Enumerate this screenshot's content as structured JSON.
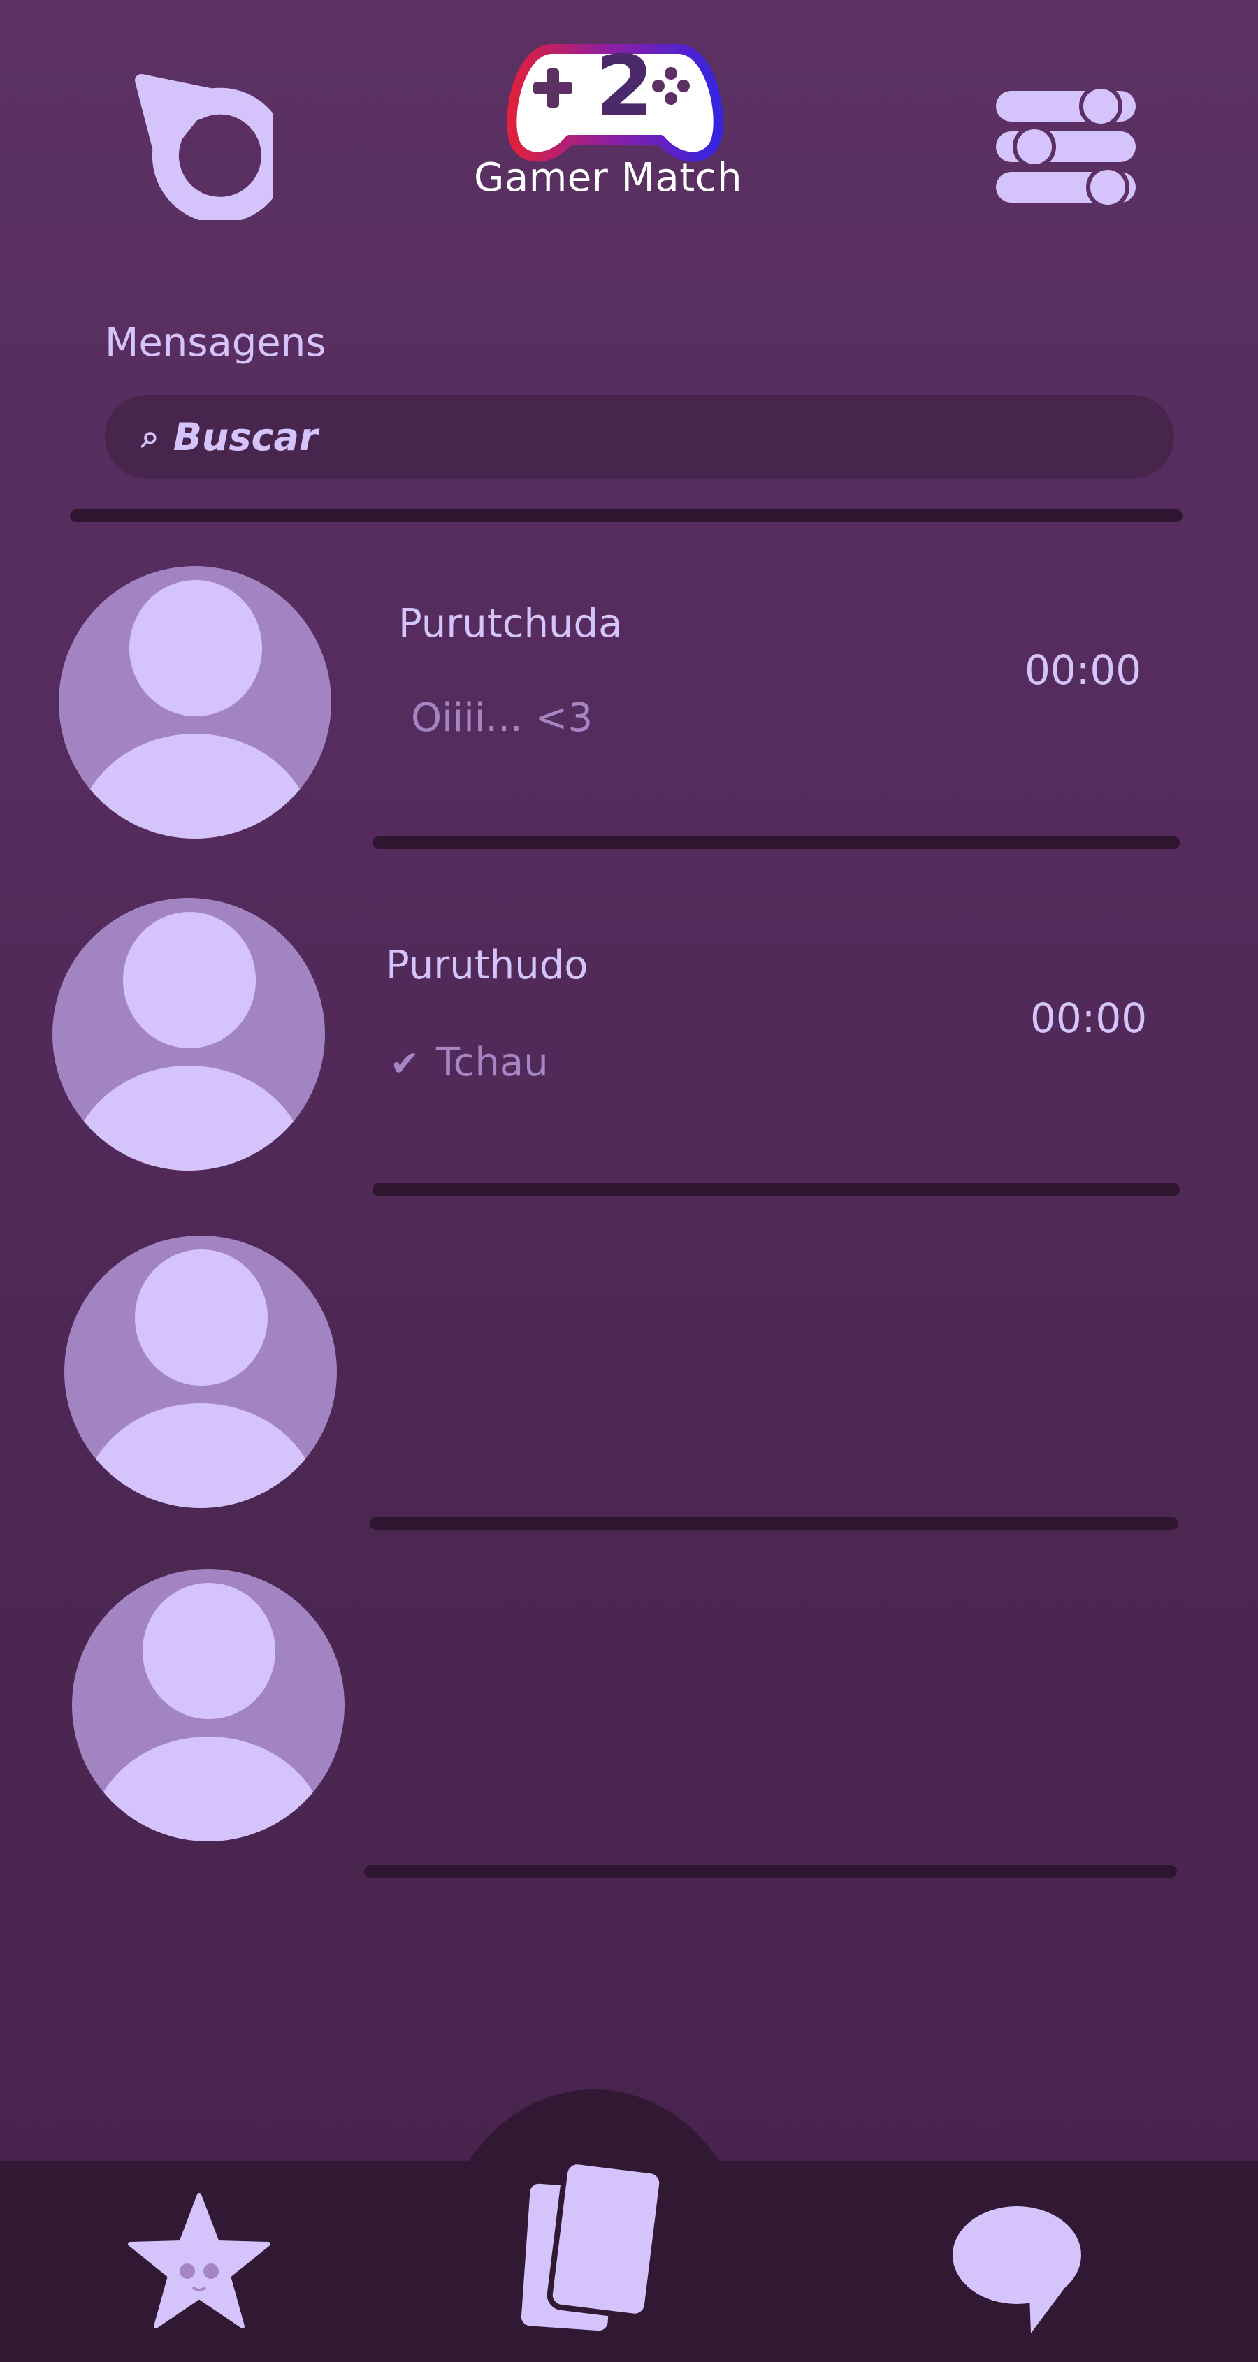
{
  "app": {
    "logo_number": "2",
    "title": "Gamer Match"
  },
  "header": {
    "refresh_icon": "refresh-icon",
    "settings_icon": "sliders-icon"
  },
  "messages": {
    "section_title": "Mensagens",
    "search": {
      "placeholder": "Buscar",
      "value": ""
    }
  },
  "chats": [
    {
      "name": "Purutchuda",
      "preview": "Oiiii... <3",
      "time": "00:00",
      "read_receipt": false
    },
    {
      "name": "Puruthudo",
      "preview": "Tchau",
      "time": "00:00",
      "read_receipt": true
    },
    {
      "name": "",
      "preview": "",
      "time": "",
      "read_receipt": false
    },
    {
      "name": "",
      "preview": "",
      "time": "",
      "read_receipt": false
    }
  ],
  "nav": {
    "items": [
      {
        "icon": "star-icon"
      },
      {
        "icon": "cards-icon"
      },
      {
        "icon": "chat-bubble-icon"
      }
    ]
  },
  "colors": {
    "background": "#5c3063",
    "accent": "#d5c3fb",
    "avatar_ring": "#a384c2",
    "nav_background": "#311833",
    "logo_red": "#e0203c",
    "logo_blue": "#3524e0"
  }
}
